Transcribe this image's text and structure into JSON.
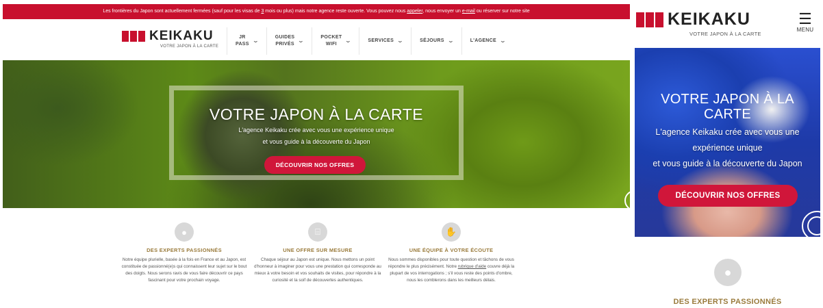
{
  "desktop": {
    "announcement": {
      "before": "Les frontières du Japon sont actuellement fermées (sauf pour les visas de ",
      "link1": "3",
      "mid1": " mois ou plus) mais notre agence reste ouverte. Vous pouvez nous ",
      "link2": "appeler",
      "mid2": ", nous envoyer un ",
      "link3": "e-mail",
      "after": " ou réserver sur notre site"
    },
    "brand": {
      "name": "KEIKAKU",
      "tagline": "VOTRE JAPON À LA CARTE"
    },
    "nav": [
      {
        "line1": "JR",
        "line2": "PASS"
      },
      {
        "line1": "GUIDES",
        "line2": "PRIVÉS"
      },
      {
        "line1": "POCKET",
        "line2": "WIFI"
      },
      {
        "line1": "SERVICES",
        "line2": ""
      },
      {
        "line1": "SÉJOURS",
        "line2": ""
      },
      {
        "line1": "L'AGENCE",
        "line2": ""
      }
    ],
    "hero": {
      "title": "VOTRE JAPON À LA CARTE",
      "sub1": "L'agence Keikaku crée avec vous une expérience unique",
      "sub2": "et vous guide à la découverte du Japon",
      "cta": "DÉCOUVRIR NOS OFFRES"
    },
    "features": [
      {
        "icon": "person-icon",
        "title": "DES EXPERTS PASSIONNÉS",
        "text": "Notre équipe plurielle, basée à la fois en France et au Japon, est constituée de passionné(e)s qui connaissent leur sujet sur le bout des doigts. Nous serons ravis de vous faire découvrir ce pays fascinant pour votre prochain voyage."
      },
      {
        "icon": "lantern-icon",
        "title": "UNE OFFRE SUR MESURE",
        "text": "Chaque séjour au Japon est unique. Nous mettons un point d'honneur à imaginer pour vous une prestation qui corresponde au mieux à votre besoin et vos souhaits de visites, pour répondre à la curiosité et la soif de découvertes authentiques."
      },
      {
        "icon": "hands-icon",
        "title": "UNE ÉQUIPE À VOTRE ÉCOUTE",
        "text_before": "Nous sommes disponibles pour toute question et tâchons de vous répondre le plus précisément. Notre ",
        "text_link": "rubrique d'aide",
        "text_after": " couvre déjà la plupart de vos interrogations ; s'il vous reste des points d'ombre, nous les comblerons dans les meilleurs délais."
      }
    ]
  },
  "mobile": {
    "brand": {
      "name": "KEIKAKU",
      "tagline": "VOTRE JAPON À LA CARTE"
    },
    "menu_label": "MENU",
    "hero": {
      "title_line1": "VOTRE JAPON À LA",
      "title_line2": "CARTE",
      "sub1": "L'agence Keikaku crée avec vous une",
      "sub2": "expérience unique",
      "sub3": "et vous guide à la découverte du Japon",
      "cta": "DÉCOUVRIR NOS OFFRES"
    },
    "feature_title": "DES EXPERTS PASSIONNÉS"
  },
  "colors": {
    "brand_red": "#c8102e",
    "gold": "#9a7b3c"
  }
}
